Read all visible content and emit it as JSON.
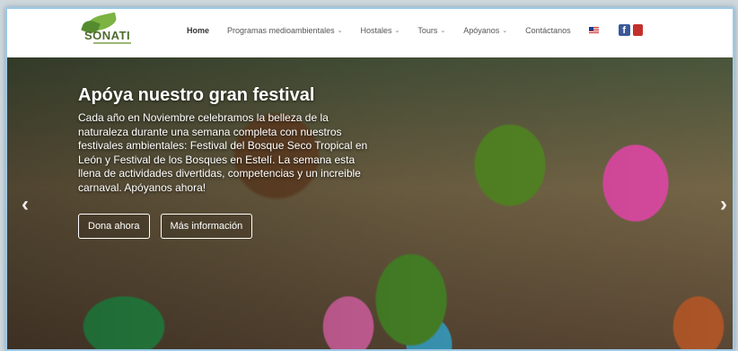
{
  "logo": {
    "brand": "SONATI"
  },
  "nav": {
    "items": [
      {
        "label": "Home",
        "dropdown": false,
        "active": true
      },
      {
        "label": "Programas medioambientales",
        "dropdown": true,
        "active": false
      },
      {
        "label": "Hostales",
        "dropdown": true,
        "active": false
      },
      {
        "label": "Tours",
        "dropdown": true,
        "active": false
      },
      {
        "label": "Apóyanos",
        "dropdown": true,
        "active": false
      },
      {
        "label": "Contáctanos",
        "dropdown": false,
        "active": false
      }
    ],
    "chevron": "⌄",
    "social": {
      "facebook": "f",
      "youtube": "You Tube"
    }
  },
  "hero": {
    "title": "Apóya nuestro gran festival",
    "text": "Cada año en Noviembre celebramos la belleza de la naturaleza durante una semana completa con nuestros festivales ambientales: Festival del Bosque Seco Tropical en León y Festival de los Bosques en Estelí. La semana esta llena de actividades divertidas, competencias y un increible carnaval. Apóyanos ahora!",
    "buttons": {
      "donate": "Dona ahora",
      "info": "Más información"
    },
    "prev": "‹",
    "next": "›"
  }
}
